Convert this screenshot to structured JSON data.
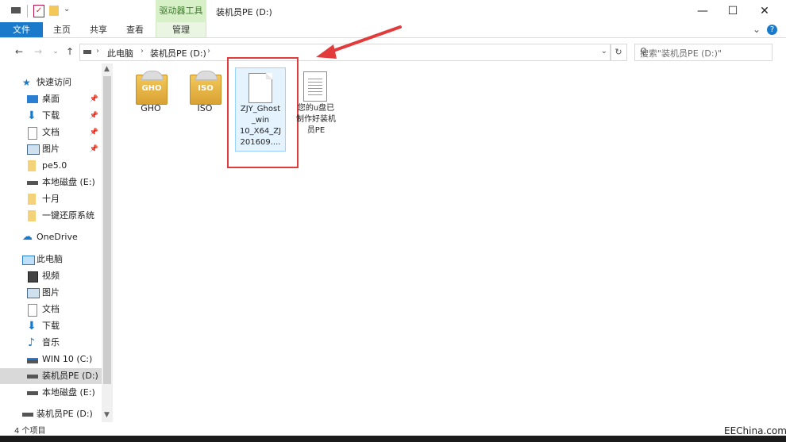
{
  "window": {
    "context_tab": "驱动器工具",
    "title": "装机员PE (D:)",
    "controls": {
      "minimize": "—",
      "maximize": "☐",
      "close": "✕"
    }
  },
  "ribbon": {
    "tabs": [
      {
        "label": "文件"
      },
      {
        "label": "主页"
      },
      {
        "label": "共享"
      },
      {
        "label": "查看"
      },
      {
        "label": "管理"
      }
    ],
    "expand": "⌄",
    "help": "?"
  },
  "address": {
    "crumbs": [
      "此电脑",
      "装机员PE (D:)"
    ],
    "search_placeholder": "搜索\"装机员PE (D:)\""
  },
  "navpane": {
    "quick_access": "快速访问",
    "quick_items": [
      "桌面",
      "下载",
      "文档",
      "图片",
      "pe5.0",
      "本地磁盘 (E:)",
      "十月",
      "一键还原系统"
    ],
    "onedrive": "OneDrive",
    "this_pc": "此电脑",
    "pc_items": [
      "视频",
      "图片",
      "文档",
      "下载",
      "音乐",
      "WIN 10 (C:)",
      "装机员PE (D:)",
      "本地磁盘 (E:)"
    ],
    "bottom_item": "装机员PE (D:)"
  },
  "files": [
    {
      "name": "GHO",
      "type": "folder",
      "icon_text": "GHO"
    },
    {
      "name": "ISO",
      "type": "folder",
      "icon_text": "ISO"
    },
    {
      "name_lines": [
        "ZJY_Ghost",
        "_win",
        "10_X64_ZJ",
        "201609...."
      ],
      "type": "file"
    },
    {
      "name_lines": [
        "您的u盘已",
        "制作好装机",
        "员PE"
      ],
      "type": "text"
    }
  ],
  "status": {
    "count": "4 个项目"
  },
  "watermark": "EEChina.com",
  "colors": {
    "accent": "#1979ca",
    "context": "#d7f0c8",
    "highlight": "#e23b3b"
  }
}
